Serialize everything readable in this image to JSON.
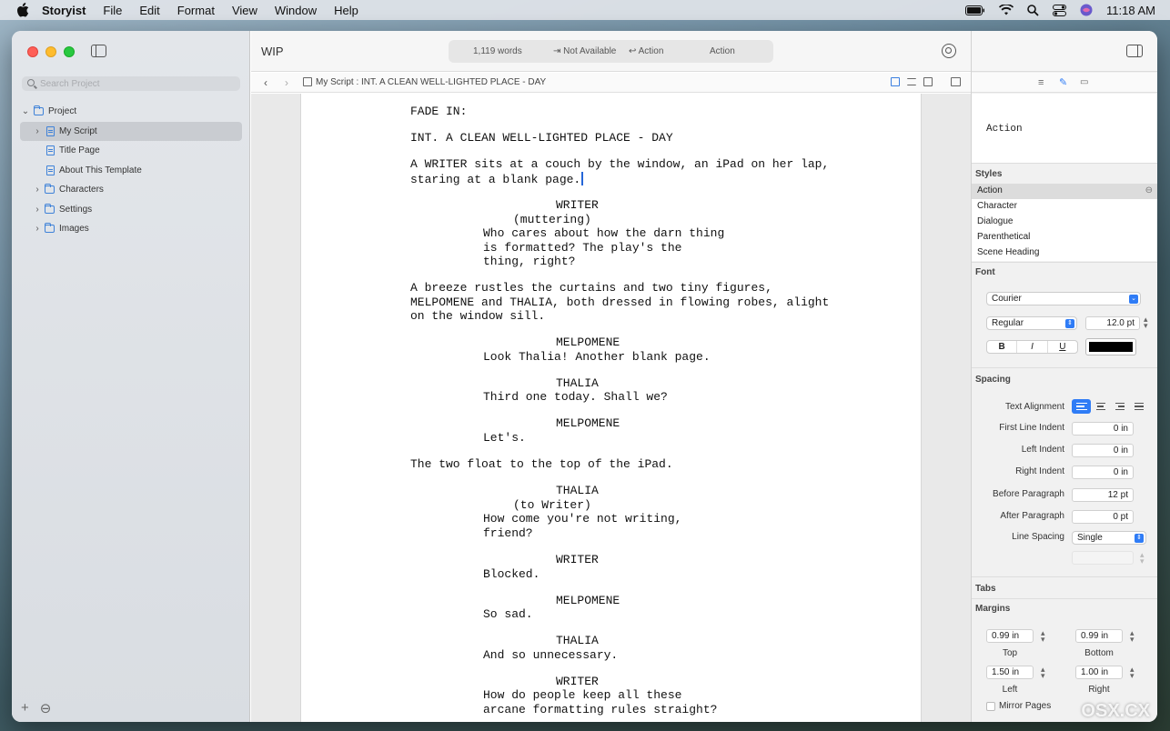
{
  "menubar": {
    "app": "Storyist",
    "items": [
      "File",
      "Edit",
      "Format",
      "View",
      "Window",
      "Help"
    ],
    "time": "11:18 AM"
  },
  "sidebar": {
    "search_placeholder": "Search Project",
    "items": [
      {
        "label": "Project",
        "icon": "project-icon"
      },
      {
        "label": "My Script",
        "icon": "script-icon"
      },
      {
        "label": "Title Page",
        "icon": "document-icon"
      },
      {
        "label": "About This Template",
        "icon": "document-icon"
      },
      {
        "label": "Characters",
        "icon": "folder-icon"
      },
      {
        "label": "Settings",
        "icon": "folder-icon"
      },
      {
        "label": "Images",
        "icon": "folder-icon"
      }
    ]
  },
  "toolbar": {
    "title": "WIP",
    "words": "1,119 words",
    "tab_next": "⇥ Not Available",
    "return_next": "↩ Action",
    "current_style": "Action"
  },
  "pathbar": {
    "doc": "My Script",
    "scene": "INT. A CLEAN WELL-LIGHTED PLACE - DAY"
  },
  "script": [
    "FADE IN:",
    "INT. A CLEAN WELL-LIGHTED PLACE - DAY",
    "A WRITER sits at a couch by the window, an iPad on her lap,",
    "staring at a blank page.",
    "WRITER",
    "(muttering)",
    "Who cares about how the darn thing",
    "is formatted? The play's the",
    "thing, right?",
    "A breeze rustles the curtains and two tiny figures,",
    "MELPOMENE and THALIA, both dressed in flowing robes, alight",
    "on the window sill.",
    "MELPOMENE",
    "Look Thalia! Another blank page.",
    "THALIA",
    "Third one today. Shall we?",
    "MELPOMENE",
    "Let's.",
    "The two float to the top of the iPad.",
    "THALIA",
    "(to Writer)",
    "How come you're not writing,",
    "friend?",
    "WRITER",
    "Blocked.",
    "MELPOMENE",
    "So sad.",
    "THALIA",
    "And so unnecessary.",
    "WRITER",
    "How do people keep all these",
    "arcane formatting rules straight?"
  ],
  "inspector": {
    "preview": "Action",
    "styles_header": "Styles",
    "styles": [
      "Action",
      "Character",
      "Dialogue",
      "Parenthetical",
      "Scene Heading"
    ],
    "font_header": "Font",
    "font_family": "Courier",
    "font_style": "Regular",
    "font_size": "12.0 pt",
    "bold": "B",
    "italic": "I",
    "underline": "U",
    "spacing_header": "Spacing",
    "text_alignment_label": "Text Alignment",
    "first_line_label": "First Line Indent",
    "first_line": "0 in",
    "left_indent_label": "Left Indent",
    "left_indent": "0 in",
    "right_indent_label": "Right Indent",
    "right_indent": "0 in",
    "before_label": "Before Paragraph",
    "before": "12 pt",
    "after_label": "After Paragraph",
    "after": "0 pt",
    "line_spacing_label": "Line Spacing",
    "line_spacing": "Single",
    "tabs_header": "Tabs",
    "margins_header": "Margins",
    "top": "0.99 in",
    "top_label": "Top",
    "bottom": "0.99 in",
    "bottom_label": "Bottom",
    "left": "1.50 in",
    "left_label": "Left",
    "right": "1.00 in",
    "right_label": "Right",
    "mirror_label": "Mirror Pages"
  },
  "watermark": "OSX.CX"
}
